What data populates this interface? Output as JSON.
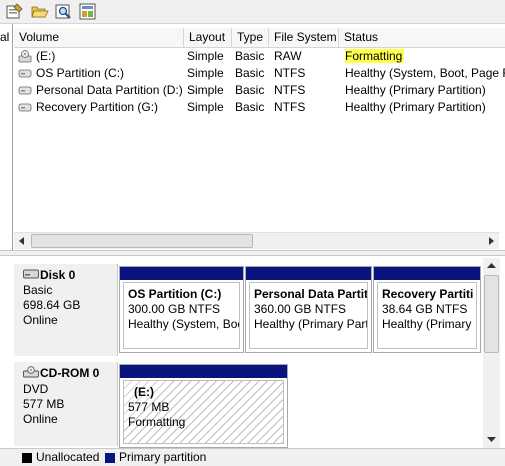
{
  "toolbar": {
    "buttons": [
      "properties-icon",
      "open-folder-icon",
      "magnifier-icon",
      "settings-panel-icon"
    ]
  },
  "upper": {
    "left_stub_text": "al",
    "columns": [
      "Volume",
      "Layout",
      "Type",
      "File System",
      "Status"
    ],
    "rows": [
      {
        "volume": "(E:)",
        "layout": "Simple",
        "type": "Basic",
        "fs": "RAW",
        "status": "Formatting",
        "icon": "cd-drive-icon"
      },
      {
        "volume": "OS Partition (C:)",
        "layout": "Simple",
        "type": "Basic",
        "fs": "NTFS",
        "status": "Healthy (System, Boot, Page F",
        "icon": "disk-volume-icon"
      },
      {
        "volume": "Personal Data Partition (D:)",
        "layout": "Simple",
        "type": "Basic",
        "fs": "NTFS",
        "status": "Healthy (Primary Partition)",
        "icon": "disk-volume-icon"
      },
      {
        "volume": "Recovery Partition (G:)",
        "layout": "Simple",
        "type": "Basic",
        "fs": "NTFS",
        "status": "Healthy (Primary Partition)",
        "icon": "disk-volume-icon"
      }
    ],
    "highlight_color": "#ffff4d"
  },
  "disks": [
    {
      "title": "Disk 0",
      "type": "Basic",
      "size": "698.64 GB",
      "state": "Online",
      "partitions": [
        {
          "name": "OS Partition  (C:)",
          "size": "300.00 GB NTFS",
          "status": "Healthy (System, Boo"
        },
        {
          "name": "Personal Data Partiti",
          "size": "360.00 GB NTFS",
          "status": "Healthy (Primary Part"
        },
        {
          "name": "Recovery Partiti",
          "size": "38.64 GB NTFS",
          "status": "Healthy (Primary"
        }
      ]
    },
    {
      "title": "CD-ROM 0",
      "type": "DVD",
      "size": "577 MB",
      "state": "Online",
      "partitions": [
        {
          "name": "(E:)",
          "size": "577 MB",
          "status": "Formatting"
        }
      ]
    }
  ],
  "legend": {
    "items": [
      {
        "label": "Unallocated",
        "color": "#000000"
      },
      {
        "label": "Primary partition",
        "color": "#0a1480"
      }
    ]
  },
  "colors": {
    "partition_bar": "#0a1480",
    "unallocated": "#000000"
  }
}
